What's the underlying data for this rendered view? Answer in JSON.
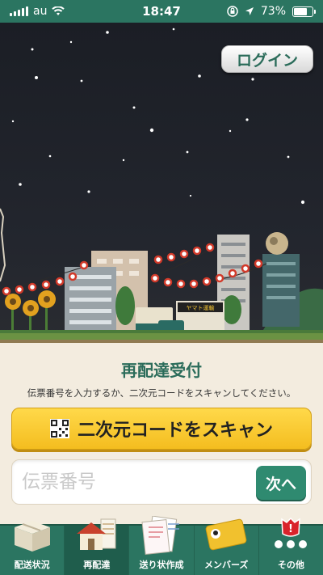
{
  "status_bar": {
    "carrier": "au",
    "time": "18:47",
    "battery_percent": "73%",
    "battery_level": 0.73
  },
  "header": {
    "login_label": "ログイン"
  },
  "scene": {
    "shop_sign": "ヤマト運輸"
  },
  "redelivery": {
    "title": "再配達受付",
    "instructions": "伝票番号を入力するか、二次元コードをスキャンしてください。",
    "scan_label": "二次元コードをスキャン",
    "tracking_placeholder": "伝票番号",
    "next_label": "次へ"
  },
  "tab_bar": {
    "tabs": [
      {
        "label": "配送状況",
        "icon": "package-box-icon",
        "active": false
      },
      {
        "label": "再配達",
        "icon": "house-icon",
        "active": true
      },
      {
        "label": "送り状作成",
        "icon": "document-icon",
        "active": false
      },
      {
        "label": "メンバーズ",
        "icon": "member-card-icon",
        "active": false
      },
      {
        "label": "その他",
        "icon": "more-dots-icon",
        "active": false
      }
    ],
    "badge": "!"
  },
  "colors": {
    "brand_green": "#2b7561",
    "accent_yellow": "#f4bd1f",
    "title_green": "#2b6c5a"
  }
}
